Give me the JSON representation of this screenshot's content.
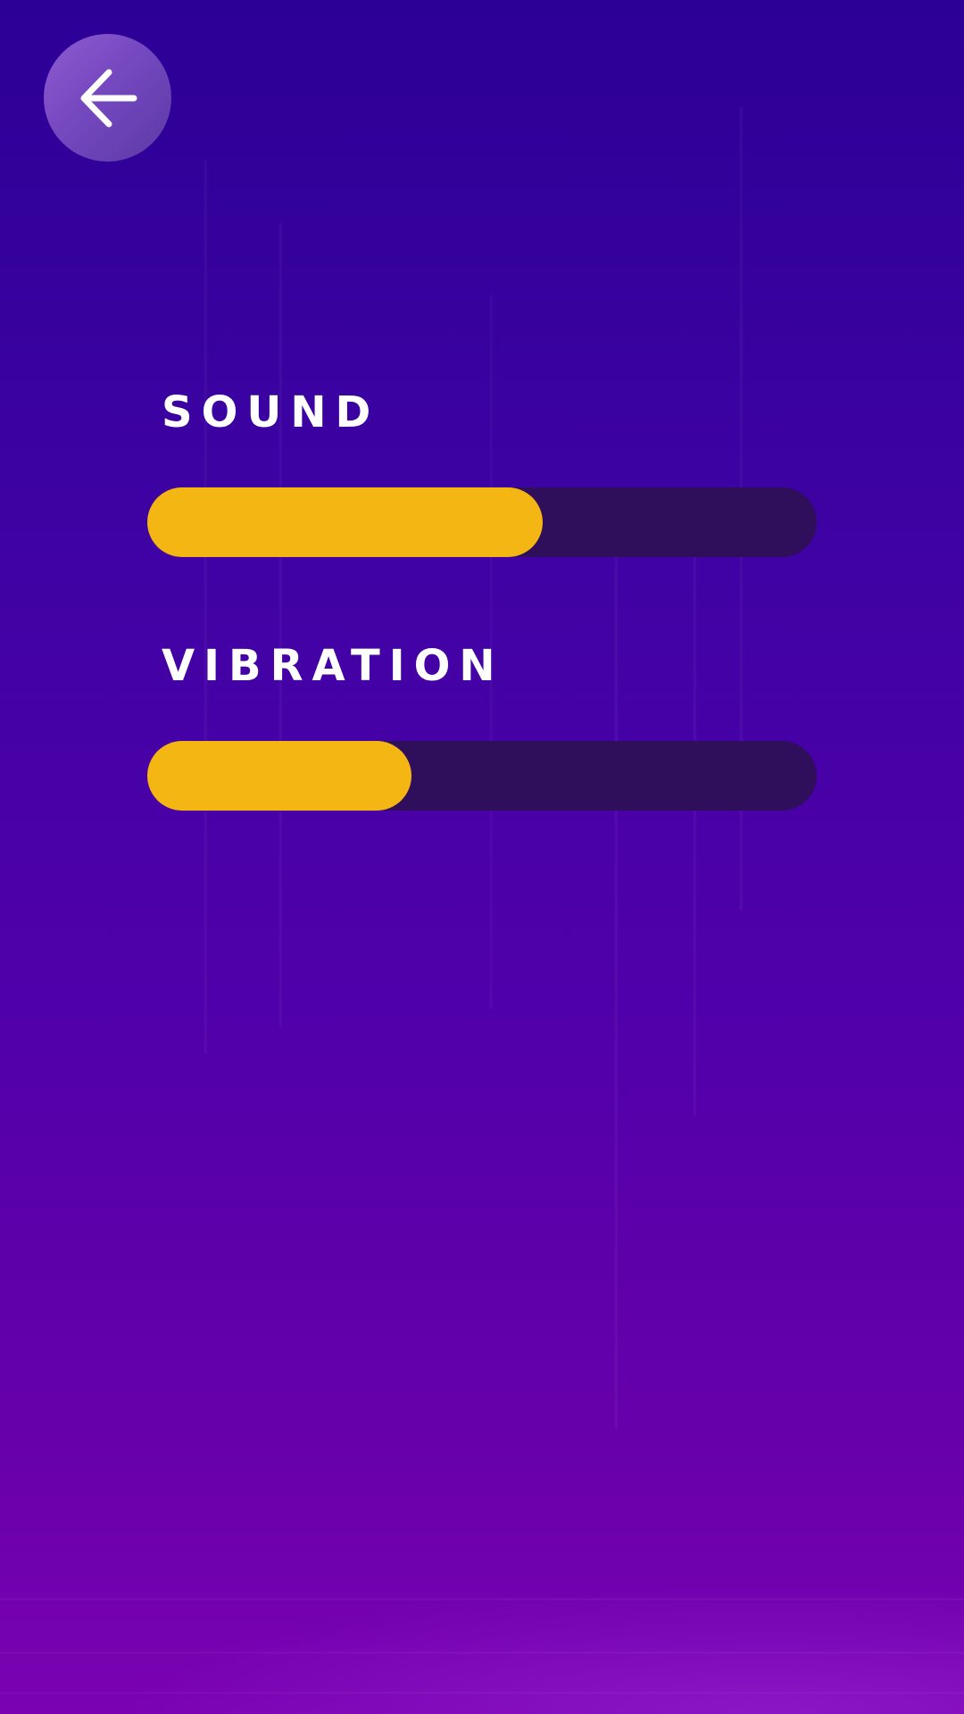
{
  "navigation": {
    "back_icon": "arrow-left-icon"
  },
  "settings": [
    {
      "label": "SOUND",
      "level": 0.59
    },
    {
      "label": "VIBRATION",
      "level": 0.395
    }
  ],
  "colors": {
    "slider_fill": "#f4b612",
    "slider_track": "#2f0e5c",
    "label_text": "#ffffff",
    "background_top": "#2c0096",
    "background_bottom": "#7a02b2",
    "back_button": "#7548c0"
  }
}
